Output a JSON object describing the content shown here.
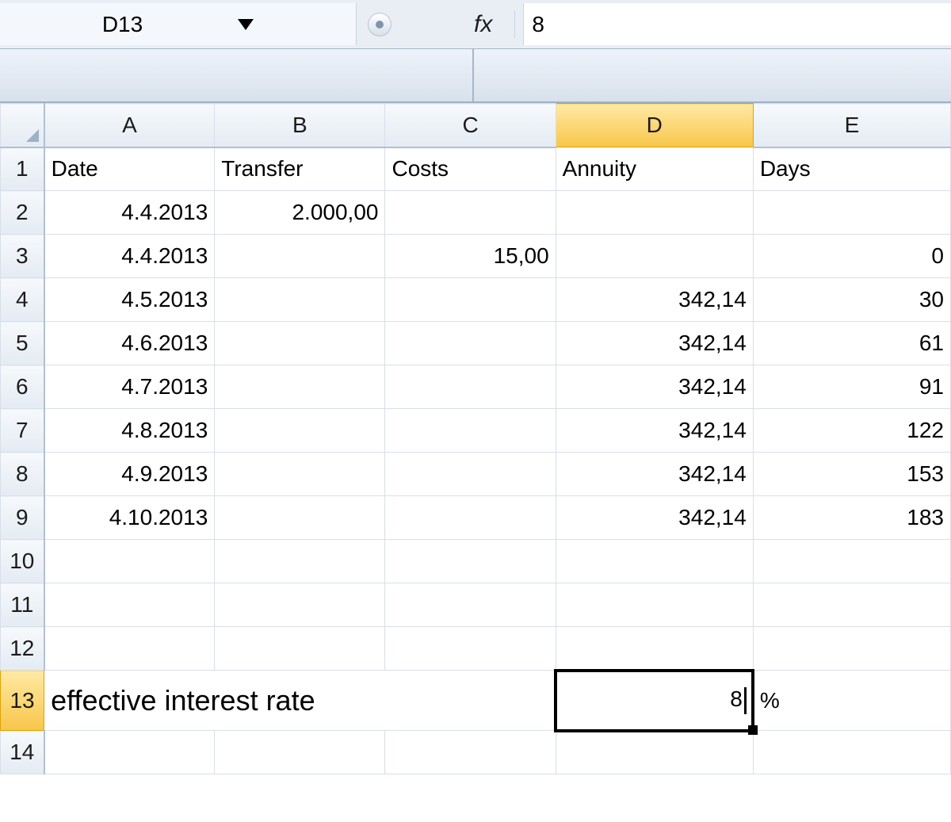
{
  "nameBox": "D13",
  "fxLabel": "fx",
  "formula": "8",
  "columns": [
    "A",
    "B",
    "C",
    "D",
    "E"
  ],
  "activeColumn": "D",
  "activeRow": 13,
  "headers": {
    "A": "Date",
    "B": "Transfer",
    "C": "Costs",
    "D": "Annuity",
    "E": "Days"
  },
  "rows": [
    {
      "n": 1,
      "A": "Date",
      "B": "Transfer",
      "C": "Costs",
      "D": "Annuity",
      "E": "Days",
      "align": {
        "A": "left",
        "B": "left",
        "C": "left",
        "D": "left",
        "E": "left"
      }
    },
    {
      "n": 2,
      "A": "4.4.2013",
      "B": "2.000,00",
      "C": "",
      "D": "",
      "E": "",
      "align": {
        "A": "right",
        "B": "right"
      }
    },
    {
      "n": 3,
      "A": "4.4.2013",
      "B": "",
      "C": "15,00",
      "D": "",
      "E": "0",
      "align": {
        "A": "right",
        "C": "right",
        "E": "right"
      }
    },
    {
      "n": 4,
      "A": "4.5.2013",
      "B": "",
      "C": "",
      "D": "342,14",
      "E": "30",
      "align": {
        "A": "right",
        "D": "right",
        "E": "right"
      }
    },
    {
      "n": 5,
      "A": "4.6.2013",
      "B": "",
      "C": "",
      "D": "342,14",
      "E": "61",
      "align": {
        "A": "right",
        "D": "right",
        "E": "right"
      }
    },
    {
      "n": 6,
      "A": "4.7.2013",
      "B": "",
      "C": "",
      "D": "342,14",
      "E": "91",
      "align": {
        "A": "right",
        "D": "right",
        "E": "right"
      }
    },
    {
      "n": 7,
      "A": "4.8.2013",
      "B": "",
      "C": "",
      "D": "342,14",
      "E": "122",
      "align": {
        "A": "right",
        "D": "right",
        "E": "right"
      }
    },
    {
      "n": 8,
      "A": "4.9.2013",
      "B": "",
      "C": "",
      "D": "342,14",
      "E": "153",
      "align": {
        "A": "right",
        "D": "right",
        "E": "right"
      }
    },
    {
      "n": 9,
      "A": "4.10.2013",
      "B": "",
      "C": "",
      "D": "342,14",
      "E": "183",
      "align": {
        "A": "right",
        "D": "right",
        "E": "right"
      }
    },
    {
      "n": 10,
      "A": "",
      "B": "",
      "C": "",
      "D": "",
      "E": ""
    },
    {
      "n": 11,
      "A": "",
      "B": "",
      "C": "",
      "D": "",
      "E": ""
    },
    {
      "n": 12,
      "A": "",
      "B": "",
      "C": "",
      "D": "",
      "E": ""
    }
  ],
  "row13": {
    "label": "effective interest rate",
    "D": "8",
    "E": "%"
  },
  "row14": {
    "n": 14
  }
}
